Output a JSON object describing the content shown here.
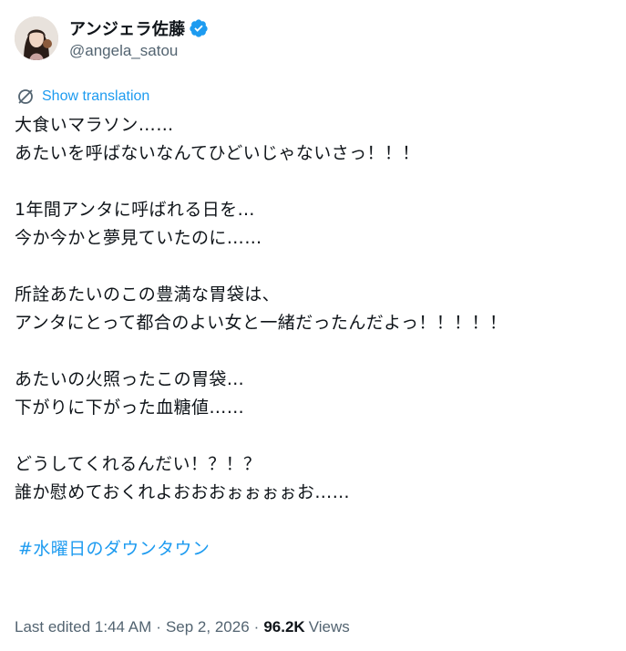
{
  "author": {
    "display_name": "アンジェラ佐藤",
    "handle": "@angela_satou",
    "verified": true,
    "avatar_icon": "avatar-icon",
    "verified_icon": "verified-badge-icon"
  },
  "translation": {
    "label": "Show translation",
    "icon": "translate-icon"
  },
  "tweet": {
    "lines": [
      "大食いマラソン……",
      "あたいを呼ばないなんてひどいじゃないさっ！！！",
      "",
      "1年間アンタに呼ばれる日を…",
      "今か今かと夢見ていたのに……",
      "",
      "所詮あたいのこの豊満な胃袋は、",
      "アンタにとって都合のよい女と一緒だったんだよっ！！！！！",
      "",
      "あたいの火照ったこの胃袋…",
      "下がりに下がった血糖値……",
      "",
      "どうしてくれるんだい！？！？",
      "誰か慰めておくれよおおおぉぉぉぉお……"
    ],
    "hashtag": "#水曜日のダウンタウン"
  },
  "meta": {
    "edited_label": "Last edited 1:44 AM",
    "separator": "·",
    "date": "Sep 2, 2026",
    "views_count": "96.2K",
    "views_label": "Views"
  },
  "colors": {
    "link": "#1d9bf0",
    "text": "#0f1419",
    "secondary": "#536471"
  }
}
